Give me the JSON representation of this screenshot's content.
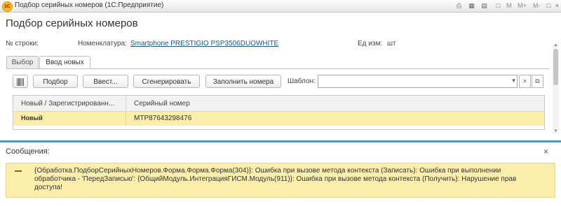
{
  "window": {
    "title": "Подбор серийных номеров  (1С:Предприятие)",
    "logo": "1С",
    "controls": [
      "print-icon",
      "calendar-icon",
      "calculator-icon",
      "doc-icon"
    ],
    "m_labels": [
      "M",
      "M+",
      "M-"
    ]
  },
  "form": {
    "title": "Подбор серийных номеров"
  },
  "header": {
    "row_label": "№ строки:",
    "nomenclature_label": "Номенклатура:",
    "nomenclature_value": "Smartphone PRESTIGIO PSP3506DUOWHITE",
    "unit_label": "Ед изм:",
    "unit_value": "шт"
  },
  "tabs": [
    {
      "label": "Выбор",
      "active": false
    },
    {
      "label": "Ввод новых",
      "active": true
    }
  ],
  "toolbar": {
    "barcode_icon": "barcode-icon",
    "select_label": "Подбор",
    "enter_label": "Ввест...",
    "generate_label": "Сгенерировать",
    "fill_label": "Заполнить номера",
    "template_label": "Шаблон:",
    "template_value": ""
  },
  "grid": {
    "columns": [
      "Новый / Зарегистрированн...",
      "Серийный номер"
    ],
    "rows": [
      {
        "status": "Новый",
        "serial": "MTP87643298476"
      }
    ]
  },
  "messages": {
    "title": "Сообщения:",
    "items": [
      "{Обработка.ПодборСерийныхНомеров.Форма.Форма.Форма(304)}: Ошибка при вызове метода контекста (Записать): Ошибка при выполнении обработчика - 'ПередЗаписью': {ОбщийМодуль.ИнтеграцияГИСМ.Модуль(911)}: Ошибка при вызове метода контекста (Получить): Нарушение прав доступа!"
    ]
  },
  "colors": {
    "accent": "#23a6e3",
    "highlight": "#fbeeab",
    "link": "#1d56a0"
  }
}
